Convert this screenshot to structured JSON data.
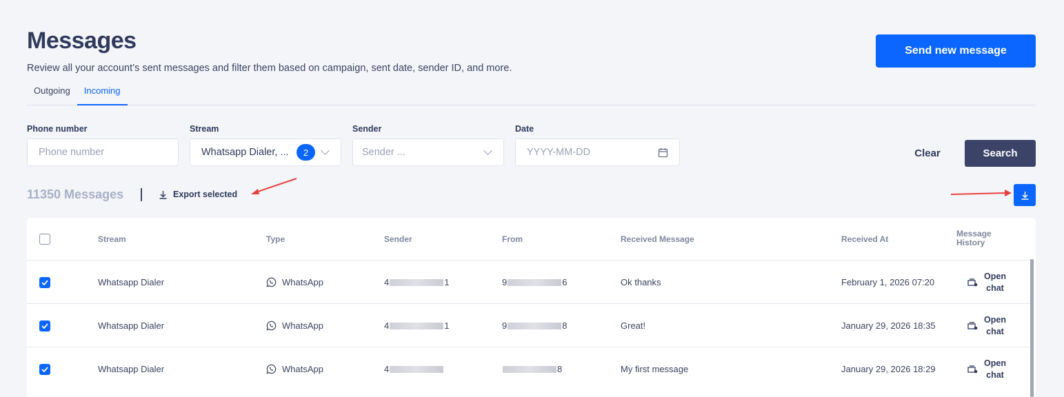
{
  "header": {
    "title": "Messages",
    "subtitle": "Review all your account’s sent messages and filter them based on campaign, sent date, sender ID, and more.",
    "send_button": "Send new message"
  },
  "tabs": [
    {
      "label": "Outgoing"
    },
    {
      "label": "Incoming",
      "active": true
    }
  ],
  "filters": {
    "phone": {
      "label": "Phone number",
      "placeholder": "Phone number"
    },
    "stream": {
      "label": "Stream",
      "value": "Whatsapp Dialer, ...",
      "badge": "2"
    },
    "sender": {
      "label": "Sender",
      "placeholder": "Sender ..."
    },
    "date": {
      "label": "Date",
      "placeholder": "YYYY-MM-DD"
    },
    "clear": "Clear",
    "search": "Search"
  },
  "summary": {
    "count": "11350 Messages",
    "export": "Export selected"
  },
  "table": {
    "headers": [
      "Stream",
      "Type",
      "Sender",
      "From",
      "Received Message",
      "Received At",
      "Message History"
    ],
    "rows": [
      {
        "stream": "Whatsapp Dialer",
        "type": "WhatsApp",
        "sender_a": "4",
        "sender_b": "1",
        "from_a": "9",
        "from_b": "6",
        "message": "Ok thanks",
        "received": "February 1, 2026 07:20",
        "action": "Open chat",
        "checked": true
      },
      {
        "stream": "Whatsapp Dialer",
        "type": "WhatsApp",
        "sender_a": "4",
        "sender_b": "1",
        "from_a": "9",
        "from_b": "8",
        "message": "Great!",
        "received": "January 29, 2026 18:35",
        "action": "Open chat",
        "checked": true
      },
      {
        "stream": "Whatsapp Dialer",
        "type": "WhatsApp",
        "sender_a": "4",
        "sender_b": "",
        "from_a": "",
        "from_b": "8",
        "message": "My first message",
        "received": "January 29, 2026 18:29",
        "action": "Open chat",
        "checked": true
      }
    ]
  },
  "colors": {
    "accent": "#0a66ff",
    "dark_button": "#3b4468",
    "annotation_arrow": "#e8413c"
  }
}
